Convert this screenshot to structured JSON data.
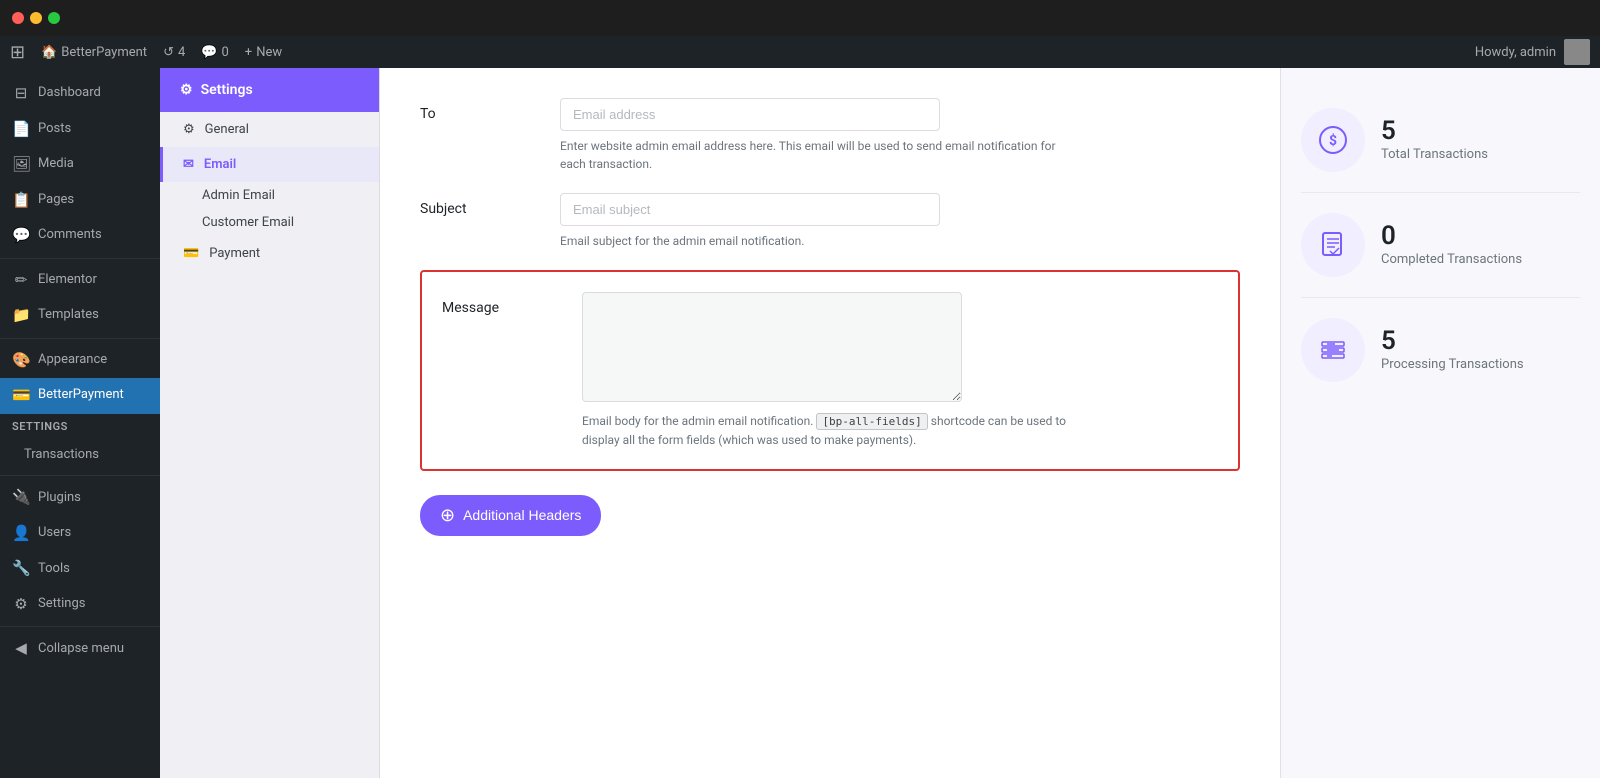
{
  "titlebar": {
    "dots": [
      "red",
      "yellow",
      "green"
    ]
  },
  "adminbar": {
    "wp_icon": "⊞",
    "site_name": "BetterPayment",
    "revision_count": "4",
    "comments_count": "0",
    "new_label": "New",
    "howdy_label": "Howdy, admin"
  },
  "sidebar": {
    "items": [
      {
        "id": "dashboard",
        "label": "Dashboard",
        "icon": "⊟"
      },
      {
        "id": "posts",
        "label": "Posts",
        "icon": "📄"
      },
      {
        "id": "media",
        "label": "Media",
        "icon": "🖼"
      },
      {
        "id": "pages",
        "label": "Pages",
        "icon": "📋"
      },
      {
        "id": "comments",
        "label": "Comments",
        "icon": "💬"
      },
      {
        "id": "elementor",
        "label": "Elementor",
        "icon": "✏"
      },
      {
        "id": "templates",
        "label": "Templates",
        "icon": "📁"
      },
      {
        "id": "appearance",
        "label": "Appearance",
        "icon": "🎨"
      },
      {
        "id": "betterpayment",
        "label": "BetterPayment",
        "icon": "💳"
      },
      {
        "id": "settings-label",
        "label": "Settings",
        "type": "section"
      },
      {
        "id": "transactions",
        "label": "Transactions",
        "type": "sub"
      },
      {
        "id": "plugins",
        "label": "Plugins",
        "icon": "🔌"
      },
      {
        "id": "users",
        "label": "Users",
        "icon": "👤"
      },
      {
        "id": "tools",
        "label": "Tools",
        "icon": "🔧"
      },
      {
        "id": "settings",
        "label": "Settings",
        "icon": "⚙"
      },
      {
        "id": "collapse",
        "label": "Collapse menu",
        "icon": "◀"
      }
    ]
  },
  "settings_sidebar": {
    "tab_label": "Settings",
    "tab_icon": "⚙",
    "nav_items": [
      {
        "id": "general",
        "label": "General",
        "icon": "⚙"
      },
      {
        "id": "email",
        "label": "Email",
        "icon": "✉",
        "active": true
      },
      {
        "id": "admin-email",
        "label": "Admin Email",
        "sub": true,
        "active": false
      },
      {
        "id": "customer-email",
        "label": "Customer Email",
        "sub": true,
        "active": false
      },
      {
        "id": "payment",
        "label": "Payment",
        "icon": "💳"
      }
    ]
  },
  "form": {
    "to_label": "To",
    "to_placeholder": "Email address",
    "to_hint": "Enter website admin email address here. This email will be used to send email notification for each transaction.",
    "subject_label": "Subject",
    "subject_placeholder": "Email subject",
    "subject_hint": "Email subject for the admin email notification.",
    "message_label": "Message",
    "message_placeholder": "",
    "message_hint_before": "Email body for the admin email notification.",
    "message_shortcode": "[bp-all-fields]",
    "message_hint_after": "shortcode can be used to display all the form fields (which was used to make payments).",
    "additional_headers_label": "Additional Headers",
    "additional_headers_icon": "+"
  },
  "stats": [
    {
      "id": "total",
      "number": "5",
      "label": "Total Transactions",
      "icon": "dollar-circle"
    },
    {
      "id": "completed",
      "number": "0",
      "label": "Completed Transactions",
      "icon": "document-check"
    },
    {
      "id": "processing",
      "number": "5",
      "label": "Processing Transactions",
      "icon": "process-lines"
    }
  ]
}
